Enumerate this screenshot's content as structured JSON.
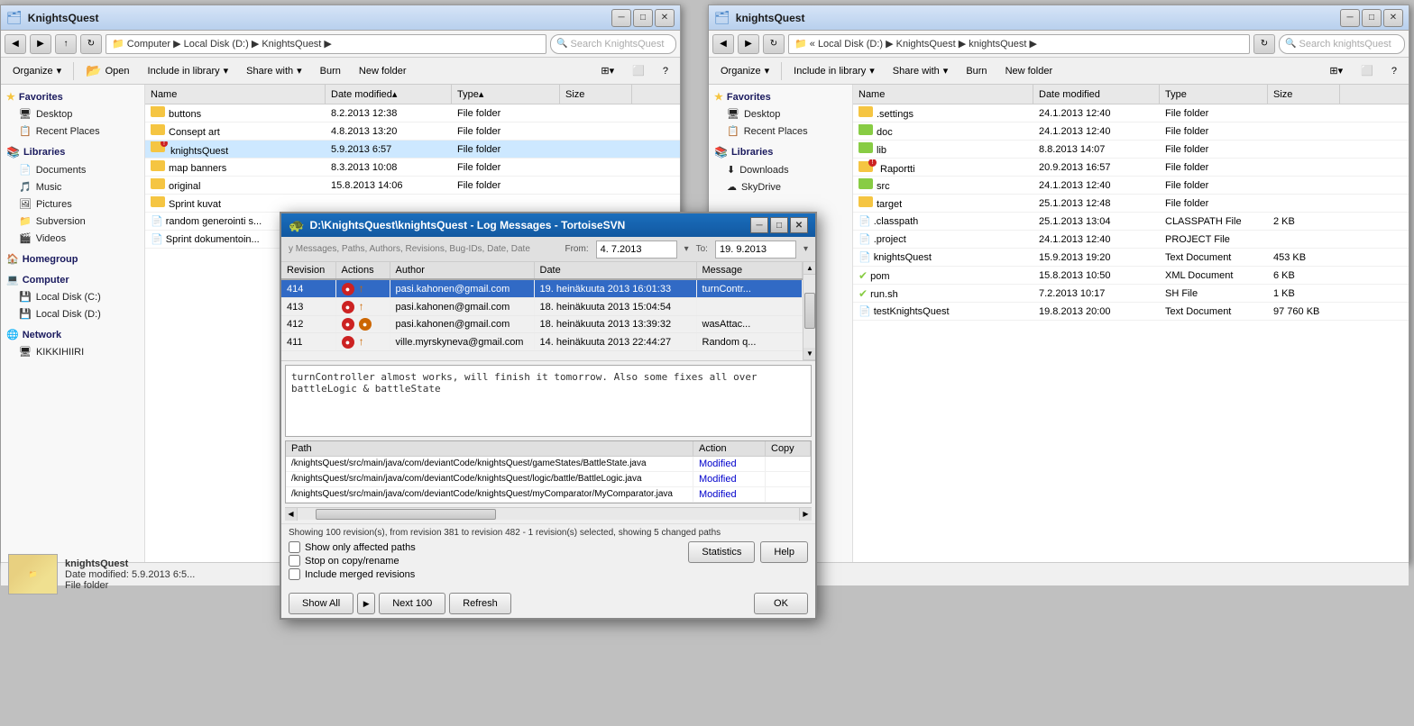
{
  "window1": {
    "title": "KnightsQuest",
    "address": "Computer ▶ Local Disk (D:) ▶ KnightsQuest ▶",
    "search_placeholder": "Search KnightsQuest",
    "toolbar": {
      "organize": "Organize",
      "open": "Open",
      "include_library": "Include in library",
      "share_with": "Share with",
      "burn": "Burn",
      "new_folder": "New folder"
    },
    "columns": [
      "Name",
      "Date modified",
      "Type",
      "Size"
    ],
    "files": [
      {
        "name": "buttons",
        "date": "8.2.2013 12:38",
        "type": "File folder",
        "size": "",
        "icon": "folder",
        "svn": ""
      },
      {
        "name": "Consept art",
        "date": "4.8.2013 13:20",
        "type": "File folder",
        "size": "",
        "icon": "folder",
        "svn": ""
      },
      {
        "name": "knightsQuest",
        "date": "5.9.2013 6:57",
        "type": "File folder",
        "size": "",
        "icon": "folder-svn",
        "svn": "",
        "selected": true
      },
      {
        "name": "map banners",
        "date": "8.3.2013 10:08",
        "type": "File folder",
        "size": "",
        "icon": "folder",
        "svn": ""
      },
      {
        "name": "original",
        "date": "15.8.2013 14:06",
        "type": "File folder",
        "size": "",
        "icon": "folder",
        "svn": ""
      },
      {
        "name": "Sprint kuvat",
        "date": "",
        "type": "",
        "size": "",
        "icon": "folder",
        "svn": ""
      },
      {
        "name": "random generointi s...",
        "date": "",
        "type": "",
        "size": "",
        "icon": "doc",
        "svn": ""
      },
      {
        "name": "Sprint dokumentoin...",
        "date": "",
        "type": "",
        "size": "",
        "icon": "doc",
        "svn": ""
      }
    ],
    "sidebar": {
      "favorites": {
        "label": "Favorites",
        "items": [
          "Desktop",
          "Recent Places"
        ]
      },
      "libraries": {
        "label": "Libraries",
        "items": [
          "Documents",
          "Music",
          "Pictures",
          "Subversion",
          "Videos"
        ]
      },
      "homegroup": {
        "label": "Homegroup"
      },
      "computer": {
        "label": "Computer",
        "items": [
          "Local Disk (C:)",
          "Local Disk (D:)"
        ]
      },
      "network": {
        "label": "Network",
        "items": [
          "KIKKIHIIRI"
        ]
      }
    },
    "status": {
      "preview_label": "knightsQuest",
      "preview_date": "Date modified: 5.9.2013 6:5...",
      "preview_type": "File folder"
    }
  },
  "window2": {
    "title": "knightsQuest",
    "address": "« Local Disk (D:) ▶ KnightsQuest ▶ knightsQuest ▶",
    "search_placeholder": "Search knightsQuest",
    "toolbar": {
      "organize": "Organize",
      "include_library": "Include in library",
      "share_with": "Share with",
      "burn": "Burn",
      "new_folder": "New folder"
    },
    "columns": [
      "Name",
      "Date modified",
      "Type",
      "Size"
    ],
    "files": [
      {
        "name": ".settings",
        "date": "24.1.2013 12:40",
        "type": "File folder",
        "size": "",
        "icon": "folder"
      },
      {
        "name": "doc",
        "date": "24.1.2013 12:40",
        "type": "File folder",
        "size": "",
        "icon": "folder-svn"
      },
      {
        "name": "lib",
        "date": "8.8.2013 14:07",
        "type": "File folder",
        "size": "",
        "icon": "folder-svn"
      },
      {
        "name": "Raportti",
        "date": "20.9.2013 16:57",
        "type": "File folder",
        "size": "",
        "icon": "folder-red"
      },
      {
        "name": "src",
        "date": "24.1.2013 12:40",
        "type": "File folder",
        "size": "",
        "icon": "folder-svn"
      },
      {
        "name": "target",
        "date": "25.1.2013 12:48",
        "type": "File folder",
        "size": "",
        "icon": "folder"
      },
      {
        "name": ".classpath",
        "date": "25.1.2013 13:04",
        "type": "CLASSPATH File",
        "size": "2 KB",
        "icon": "doc"
      },
      {
        "name": ".project",
        "date": "24.1.2013 12:40",
        "type": "PROJECT File",
        "size": "",
        "icon": "doc"
      },
      {
        "name": "knightsQuest",
        "date": "15.9.2013 19:20",
        "type": "Text Document",
        "size": "453 KB",
        "icon": "doc"
      },
      {
        "name": "pom",
        "date": "15.8.2013 10:50",
        "type": "XML Document",
        "size": "6 KB",
        "icon": "doc-svn"
      },
      {
        "name": "run.sh",
        "date": "7.2.2013 10:17",
        "type": "SH File",
        "size": "1 KB",
        "icon": "doc-svn"
      },
      {
        "name": "testKnightsQuest",
        "date": "19.8.2013 20:00",
        "type": "Text Document",
        "size": "97 760 KB",
        "icon": "doc"
      }
    ],
    "sidebar": {
      "favorites": {
        "label": "Favorites",
        "items": [
          "Desktop",
          "Recent Places"
        ]
      },
      "libraries": {
        "label": "Libraries",
        "items": [
          "Downloads",
          "SkyDrive"
        ]
      }
    }
  },
  "svn_dialog": {
    "title": "D:\\KnightsQuest\\knightsQuest - Log Messages - TortoiseSVN",
    "filter_label": "y Messages, Paths, Authors, Revisions, Bug-IDs, Date, Date",
    "from_label": "From:",
    "from_date": "4. 7.2013",
    "to_label": "To:",
    "to_date": "19. 9.2013",
    "columns": [
      "Revision",
      "Actions",
      "Author",
      "Date",
      "Message"
    ],
    "revisions": [
      {
        "rev": "414",
        "actions": "●",
        "author": "pasi.kahonen@gmail.com",
        "date": "19. heinäkuuta 2013 16:01:33",
        "message": "turnContr...",
        "selected": true
      },
      {
        "rev": "413",
        "actions": "●",
        "author": "pasi.kahonen@gmail.com",
        "date": "18. heinäkuuta 2013 15:04:54",
        "message": ""
      },
      {
        "rev": "412",
        "actions": "●●",
        "author": "pasi.kahonen@gmail.com",
        "date": "18. heinäkuuta 2013 13:39:32",
        "message": "wasAttac..."
      },
      {
        "rev": "411",
        "actions": "●",
        "author": "ville.myrskyneva@gmail.com",
        "date": "14. heinäkuuta 2013 22:44:27",
        "message": "Random q..."
      }
    ],
    "message_text": "turnController almost works, will finish it tomorrow. Also some fixes all over\nbattleLogic & battleState",
    "paths_columns": [
      "Path",
      "Action",
      "Copy"
    ],
    "paths": [
      {
        "path": "/knightsQuest/src/main/java/com/deviantCode/knightsQuest/gameStates/BattleState.java",
        "action": "Modified",
        "copy": ""
      },
      {
        "path": "/knightsQuest/src/main/java/com/deviantCode/knightsQuest/logic/battle/BattleLogic.java",
        "action": "Modified",
        "copy": ""
      },
      {
        "path": "/knightsQuest/src/main/java/com/deviantCode/knightsQuest/myComparator/MyComparator.java",
        "action": "Modified",
        "copy": ""
      }
    ],
    "status_text": "Showing 100 revision(s), from revision 381 to revision 482 - 1 revision(s) selected, showing 5 changed paths",
    "checkboxes": {
      "affected_paths": "Show only affected paths",
      "stop_copy": "Stop on copy/rename",
      "include_merged": "Include merged revisions"
    },
    "buttons": {
      "show_all": "Show All",
      "next_100": "Next 100",
      "refresh": "Refresh",
      "statistics": "Statistics",
      "help": "Help",
      "ok": "OK"
    }
  }
}
